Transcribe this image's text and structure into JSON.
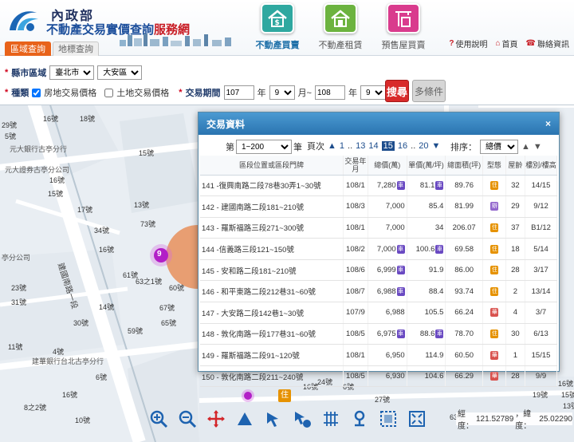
{
  "header": {
    "ministry": "內政部",
    "title_main": "不動產交易實價查詢",
    "title_accent": "服務網",
    "tabs": [
      {
        "label": "不動產買賣",
        "color": "#2fa8a0",
        "active": true
      },
      {
        "label": "不動產租賃",
        "color": "#6cb33f",
        "active": false
      },
      {
        "label": "預售屋買賣",
        "color": "#d93b8d",
        "active": false
      }
    ],
    "links": [
      "使用說明",
      "首頁",
      "聯絡資訊"
    ],
    "modes": [
      "區域查詢",
      "地標查詢"
    ]
  },
  "search": {
    "region_label": "縣市區域",
    "city": "臺北市",
    "district": "大安區",
    "type_label": "種類",
    "type_option1": "房地交易價格",
    "type_option2": "土地交易價格",
    "period_label": "交易期間",
    "from_year": "107",
    "from_month": "9",
    "to_year": "108",
    "to_month": "9",
    "year_unit": "年",
    "month_unit": "月~",
    "month_end": "月",
    "search_button": "搜尋",
    "more_button": "多條件"
  },
  "panel": {
    "title": "交易資料",
    "close": "×",
    "range_prefix": "第",
    "range": "1~200",
    "range_suffix": "筆",
    "page_label": "頁次",
    "page_first": "1",
    "page_dots": "..",
    "page_13": "13",
    "page_14": "14",
    "page_current": "15",
    "page_16": "16",
    "page_dots2": "..",
    "page_last": "20",
    "sort_label": "排序：",
    "sort_value": "總價",
    "columns": [
      "區段位置或區段門牌",
      "交易年月",
      "總價(萬)",
      "單價(萬/坪)",
      "總面積(坪)",
      "型態",
      "屋齡",
      "樓別/樓高"
    ],
    "rows": [
      {
        "addr": "141 -復興南路二段78巷30弄1~30號",
        "ym": "108/1",
        "total": "7,280",
        "tb": "車",
        "unit": "81.1",
        "ub": "車",
        "area": "89.76",
        "type": "住",
        "age": "32",
        "floor": "14/15"
      },
      {
        "addr": "142 - 建國南路二段181~210號",
        "ym": "108/3",
        "total": "7,000",
        "tb": "",
        "unit": "85.4",
        "ub": "",
        "area": "81.99",
        "type": "辦",
        "age": "29",
        "floor": "9/12"
      },
      {
        "addr": "143 - 羅斯福路三段271~300號",
        "ym": "108/1",
        "total": "7,000",
        "tb": "",
        "unit": "34",
        "ub": "",
        "area": "206.07",
        "type": "住",
        "age": "37",
        "floor": "B1/12"
      },
      {
        "addr": "144 -信義路三段121~150號",
        "ym": "108/2",
        "total": "7,000",
        "tb": "車",
        "unit": "100.6",
        "ub": "車",
        "area": "69.58",
        "type": "住",
        "age": "18",
        "floor": "5/14"
      },
      {
        "addr": "145 - 安和路二段181~210號",
        "ym": "108/6",
        "total": "6,999",
        "tb": "車",
        "unit": "91.9",
        "ub": "",
        "area": "86.00",
        "type": "住",
        "age": "28",
        "floor": "3/17"
      },
      {
        "addr": "146 - 和平東路二段212巷31~60號",
        "ym": "108/7",
        "total": "6,988",
        "tb": "車",
        "unit": "88.4",
        "ub": "",
        "area": "93.74",
        "type": "住",
        "age": "2",
        "floor": "13/14"
      },
      {
        "addr": "147 - 大安路二段142巷1~30號",
        "ym": "107/9",
        "total": "6,988",
        "tb": "",
        "unit": "105.5",
        "ub": "",
        "area": "66.24",
        "type": "華",
        "age": "4",
        "floor": "3/7"
      },
      {
        "addr": "148 - 敦化南路一段177巷31~60號",
        "ym": "108/5",
        "total": "6,975",
        "tb": "車",
        "unit": "88.6",
        "ub": "車",
        "area": "78.70",
        "type": "住",
        "age": "30",
        "floor": "6/13"
      },
      {
        "addr": "149 - 羅斯福路二段91~120號",
        "ym": "108/1",
        "total": "6,950",
        "tb": "",
        "unit": "114.9",
        "ub": "",
        "area": "60.50",
        "type": "華",
        "age": "1",
        "floor": "15/15"
      },
      {
        "addr": "150 - 敦化南路二段211~240號",
        "ym": "108/5",
        "total": "6,930",
        "tb": "",
        "unit": "104.6",
        "ub": "",
        "area": "66.29",
        "type": "華",
        "age": "28",
        "floor": "9/9"
      }
    ]
  },
  "map": {
    "labels": [
      "16號",
      "18號",
      "29號",
      "5號",
      "元大銀行古亭分行",
      "元大證券古亭分公司",
      "15號",
      "16號",
      "15號",
      "13號",
      "17號",
      "73號",
      "34號",
      "亭分公司",
      "16號",
      "63之1號",
      "61號",
      "60號",
      "23號",
      "67號",
      "31號",
      "14號",
      "建國南路一段",
      "30號",
      "65號",
      "59號",
      "11號",
      "建華銀行台北古亭分行",
      "4號",
      "6號",
      "16號",
      "8之2號",
      "10號",
      "16號",
      "6號",
      "24號",
      "27號",
      "16號",
      "15號",
      "13號",
      "19號",
      "63號"
    ],
    "cluster_count": "9",
    "street": "建國南路一段"
  },
  "coords": {
    "lon_label": "經度：",
    "lon": "121.52789",
    "lat_label": "，緯度：",
    "lat": "25.02290"
  },
  "tools": [
    "zoom-in-icon",
    "zoom-out-icon",
    "pan-icon",
    "measure-area-icon",
    "select-icon",
    "select-plus-icon",
    "grid-icon",
    "pin-icon",
    "frame-icon",
    "fullscreen-icon"
  ]
}
